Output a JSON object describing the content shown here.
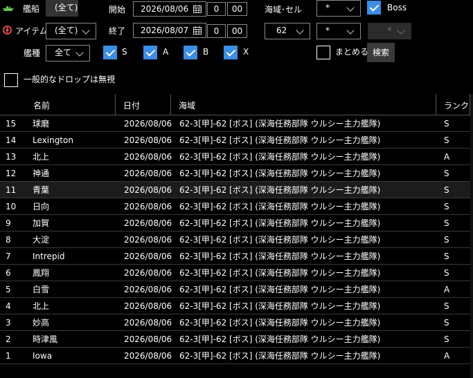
{
  "filters": {
    "ship_label": "艦船",
    "ship_value": "(全て)",
    "item_label": "アイテム",
    "item_value": "(全て)",
    "shiptype_label": "艦種",
    "shiptype_value": "全て",
    "start_label": "開始",
    "start_date": "2026/08/06",
    "start_hour": "0",
    "start_min": "00",
    "end_label": "終了",
    "end_date": "2026/08/07",
    "end_hour": "0",
    "end_min": "00",
    "area_cell_label": "海域･セル",
    "area_value": "62",
    "cell_value1": "*",
    "cell_value2": "*",
    "cell_value3": "*",
    "boss_label": "Boss",
    "boss_checked": true,
    "rank_s": "S",
    "rank_a": "A",
    "rank_b": "B",
    "rank_x": "X",
    "merge_label": "まとめる",
    "merge_checked": false,
    "search_label": "検索",
    "ignore_common_label": "一般的なドロップは無視",
    "ignore_common_checked": false
  },
  "icons": {
    "ship": "ship-icon",
    "item": "item-icon",
    "calendar": "calendar-icon"
  },
  "colors": {
    "accent": "#3b8ee6",
    "ship_icon": "#5ec24a",
    "item_icon": "#d94a4a"
  },
  "table": {
    "columns": [
      "名前",
      "日付",
      "海域",
      "ランク"
    ],
    "selected_index": 4,
    "rows": [
      [
        "15",
        "球磨",
        "2026/08/06",
        "62-3[甲]-62 [ボス] (深海任務部隊 ウルシー主力艦隊)",
        "S"
      ],
      [
        "14",
        "Lexington",
        "2026/08/06",
        "62-3[甲]-62 [ボス] (深海任務部隊 ウルシー主力艦隊)",
        "S"
      ],
      [
        "13",
        "北上",
        "2026/08/06",
        "62-3[甲]-62 [ボス] (深海任務部隊 ウルシー主力艦隊)",
        "A"
      ],
      [
        "12",
        "神通",
        "2026/08/06",
        "62-3[甲]-62 [ボス] (深海任務部隊 ウルシー主力艦隊)",
        "S"
      ],
      [
        "11",
        "青葉",
        "2026/08/06",
        "62-3[甲]-62 [ボス] (深海任務部隊 ウルシー主力艦隊)",
        "S"
      ],
      [
        "10",
        "日向",
        "2026/08/06",
        "62-3[甲]-62 [ボス] (深海任務部隊 ウルシー主力艦隊)",
        "S"
      ],
      [
        "9",
        "加賀",
        "2026/08/06",
        "62-3[甲]-62 [ボス] (深海任務部隊 ウルシー主力艦隊)",
        "S"
      ],
      [
        "8",
        "大淀",
        "2026/08/06",
        "62-3[甲]-62 [ボス] (深海任務部隊 ウルシー主力艦隊)",
        "S"
      ],
      [
        "7",
        "Intrepid",
        "2026/08/06",
        "62-3[甲]-62 [ボス] (深海任務部隊 ウルシー主力艦隊)",
        "S"
      ],
      [
        "6",
        "鳳翔",
        "2026/08/06",
        "62-3[甲]-62 [ボス] (深海任務部隊 ウルシー主力艦隊)",
        "S"
      ],
      [
        "5",
        "白雪",
        "2026/08/06",
        "62-3[甲]-62 [ボス] (深海任務部隊 ウルシー主力艦隊)",
        "A"
      ],
      [
        "4",
        "北上",
        "2026/08/06",
        "62-3[甲]-62 [ボス] (深海任務部隊 ウルシー主力艦隊)",
        "S"
      ],
      [
        "3",
        "妙高",
        "2026/08/06",
        "62-3[甲]-62 [ボス] (深海任務部隊 ウルシー主力艦隊)",
        "S"
      ],
      [
        "2",
        "時津風",
        "2026/08/06",
        "62-3[甲]-62 [ボス] (深海任務部隊 ウルシー主力艦隊)",
        "S"
      ],
      [
        "1",
        "Iowa",
        "2026/08/06",
        "62-3[甲]-62 [ボス] (深海任務部隊 ウルシー主力艦隊)",
        "A"
      ]
    ]
  }
}
